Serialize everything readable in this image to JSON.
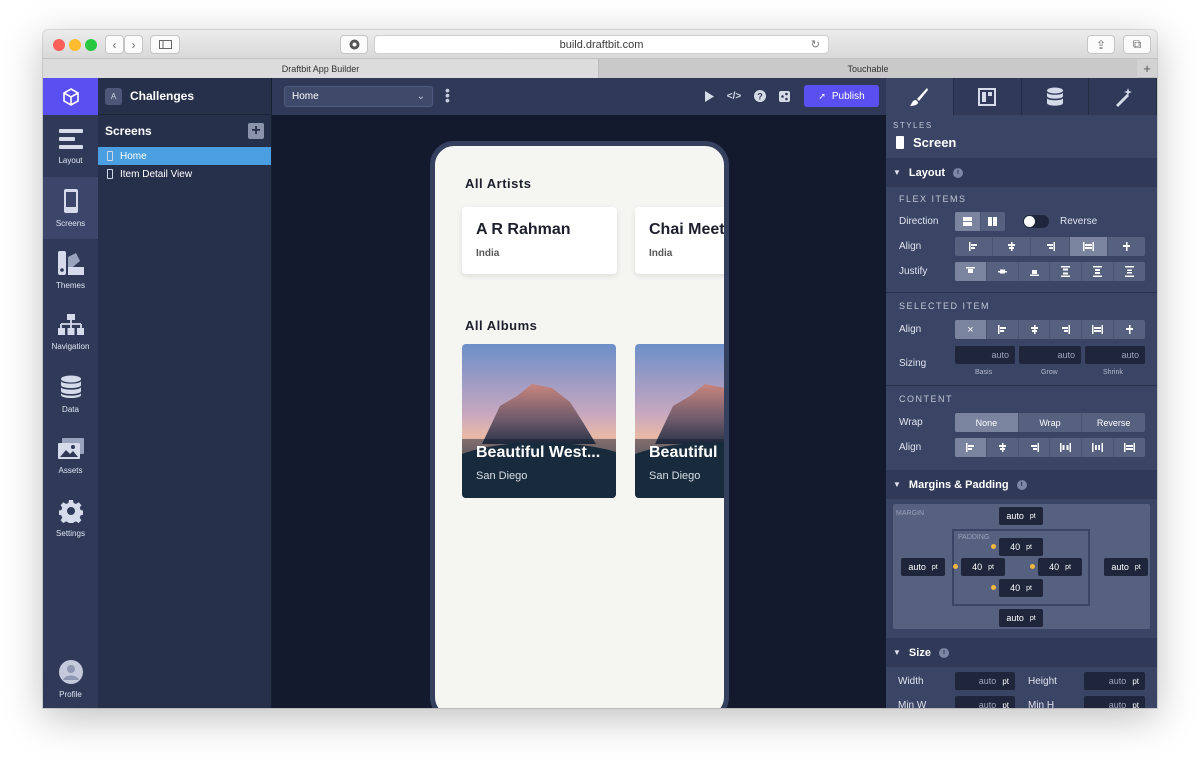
{
  "browser": {
    "url": "build.draftbit.com",
    "tabs": [
      "Draftbit App Builder",
      "Touchable"
    ],
    "add_tab": "+"
  },
  "rail": {
    "items": [
      {
        "label": "Layout",
        "icon": "layout-icon"
      },
      {
        "label": "Screens",
        "icon": "phone-icon"
      },
      {
        "label": "Themes",
        "icon": "palette-icon"
      },
      {
        "label": "Navigation",
        "icon": "sitemap-icon"
      },
      {
        "label": "Data",
        "icon": "database-icon"
      },
      {
        "label": "Assets",
        "icon": "images-icon"
      },
      {
        "label": "Settings",
        "icon": "gear-icon"
      }
    ],
    "profile": "Profile",
    "active": "Screens"
  },
  "project": {
    "avatar": "A",
    "name": "Challenges"
  },
  "screens": {
    "heading": "Screens",
    "add": "+",
    "items": [
      "Home",
      "Item Detail View"
    ],
    "selected": "Home"
  },
  "toolbar": {
    "screen_select": "Home",
    "publish": "Publish"
  },
  "phone": {
    "artists_title": "All Artists",
    "artists": [
      {
        "name": "A R Rahman",
        "country": "India"
      },
      {
        "name": "Chai Meet",
        "country": "India"
      }
    ],
    "albums_title": "All Albums",
    "albums": [
      {
        "title": "Beautiful West...",
        "place": "San Diego"
      },
      {
        "title": "Beautiful",
        "place": "San Diego"
      }
    ]
  },
  "panel": {
    "styles_label": "STYLES",
    "component": "Screen",
    "layout": {
      "title": "Layout",
      "flex_items": "FLEX ITEMS",
      "direction": "Direction",
      "reverse": "Reverse",
      "align": "Align",
      "justify": "Justify",
      "selected_item": "SELECTED ITEM",
      "sizing": "Sizing",
      "basis": "Basis",
      "grow": "Grow",
      "shrink": "Shrink",
      "auto": "auto",
      "content": "CONTENT",
      "wrap": "Wrap",
      "wrap_options": [
        "None",
        "Wrap",
        "Reverse"
      ],
      "wrap_selected": "None",
      "clear": "×"
    },
    "margins": {
      "title": "Margins & Padding",
      "margin_label": "MARGIN",
      "padding_label": "PADDING",
      "auto": "auto",
      "unit": "pt",
      "padding_top": "40",
      "padding_left": "40",
      "padding_right": "40",
      "padding_bottom": "40"
    },
    "size": {
      "title": "Size",
      "width": "Width",
      "height": "Height",
      "min_w": "Min W",
      "min_h": "Min H",
      "auto": "auto",
      "unit": "pt"
    }
  },
  "colors": {
    "accent": "#5a4ff0",
    "selected": "#4a9fe0",
    "sidebar": "#303a58",
    "canvas": "#141a2e",
    "padding_dot": "#f0b840"
  }
}
